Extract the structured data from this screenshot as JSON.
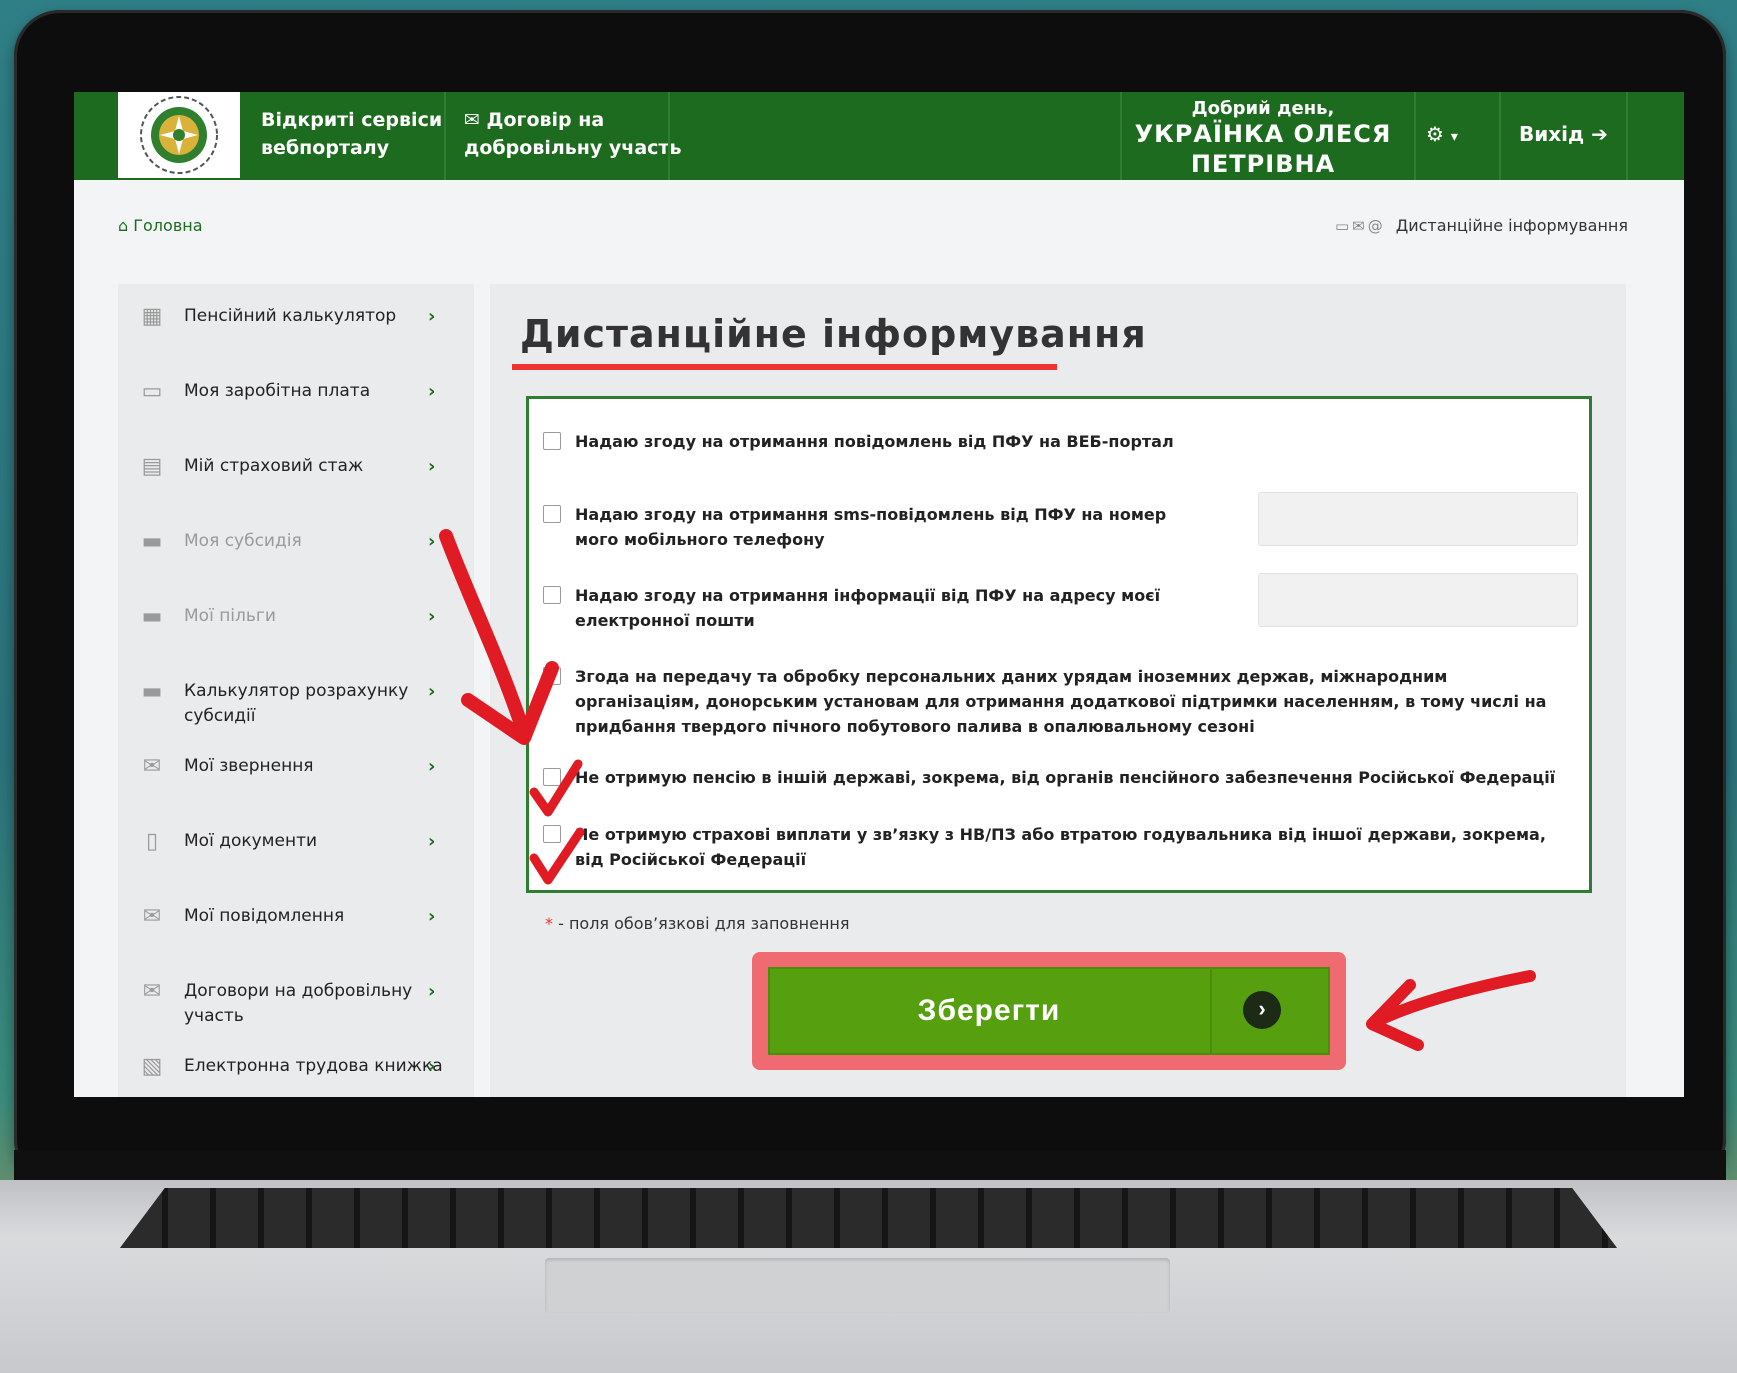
{
  "header": {
    "nav_open_services": "Відкриті сервіси\nвебпорталу",
    "nav_open_services_l1": "Відкриті сервіси",
    "nav_open_services_l2": "вебпорталу",
    "nav_contract_l1": "Договір на",
    "nav_contract_l2": "добровільну участь",
    "greeting": "Добрий день,",
    "user_name_l1": "УКРАЇНКА ОЛЕСЯ",
    "user_name_l2": "ПЕТРІВНА",
    "settings_caret": "▾",
    "logout": "Вихід"
  },
  "breadcrumb": {
    "home": "Головна",
    "current": "Дистанційне інформування"
  },
  "sidebar": {
    "items": [
      {
        "label": "Пенсійний калькулятор",
        "icon": "calculator-icon",
        "muted": false
      },
      {
        "label": "Моя заробітна плата",
        "icon": "wallet-icon",
        "muted": false
      },
      {
        "label": "Мій страховий стаж",
        "icon": "calendar-icon",
        "muted": false
      },
      {
        "label": "Моя субсидія",
        "icon": "folder-icon",
        "muted": true
      },
      {
        "label": "Мої пільги",
        "icon": "folder-icon",
        "muted": true
      },
      {
        "label": "Калькулятор розрахунку субсидії",
        "icon": "folder-icon",
        "muted": false
      },
      {
        "label": "Мої звернення",
        "icon": "envelope-icon",
        "muted": false
      },
      {
        "label": "Мої документи",
        "icon": "document-icon",
        "muted": false
      },
      {
        "label": "Мої повідомлення",
        "icon": "mail-icon",
        "muted": false
      },
      {
        "label": "Договори на добровільну участь",
        "icon": "mail-icon",
        "muted": false
      },
      {
        "label": "Електронна трудова книжка",
        "icon": "book-icon",
        "muted": false
      }
    ]
  },
  "main": {
    "title": "Дистанційне інформування",
    "options": [
      {
        "label": "Надаю згоду на отримання повідомлень від ПФУ на ВЕБ-портал",
        "has_input": false
      },
      {
        "label": "Надаю згоду на отримання sms-повідомлень від ПФУ на номер мого мобільного телефону",
        "has_input": true
      },
      {
        "label": "Надаю згоду на отримання інформації від ПФУ на адресу моєї електронної пошти",
        "has_input": true
      },
      {
        "label": "Згода на передачу та обробку персональних даних урядам іноземних держав, міжнародним організаціям, донорським установам для отримання додаткової підтримки населенням, в тому числі на придбання твердого пічного побутового палива в опалювальному сезоні",
        "has_input": false
      },
      {
        "label": "Не отримую пенсію в іншій державі, зокрема, від органів пенсійного забезпечення Російської Федерації",
        "has_input": false
      },
      {
        "label": "Не отримую страхові виплати у зв’язку з НВ/ПЗ або втратою годувальника від іншої держави, зокрема, від Російської Федерації",
        "has_input": false
      }
    ],
    "required_star": "*",
    "required_note": " - поля обов’язкові для заповнення",
    "save_label": "Зберегти",
    "save_arrow": "›"
  },
  "colors": {
    "header_green": "#1d6b1f",
    "button_green": "#56a00f",
    "annotation_red": "#e01b24"
  }
}
